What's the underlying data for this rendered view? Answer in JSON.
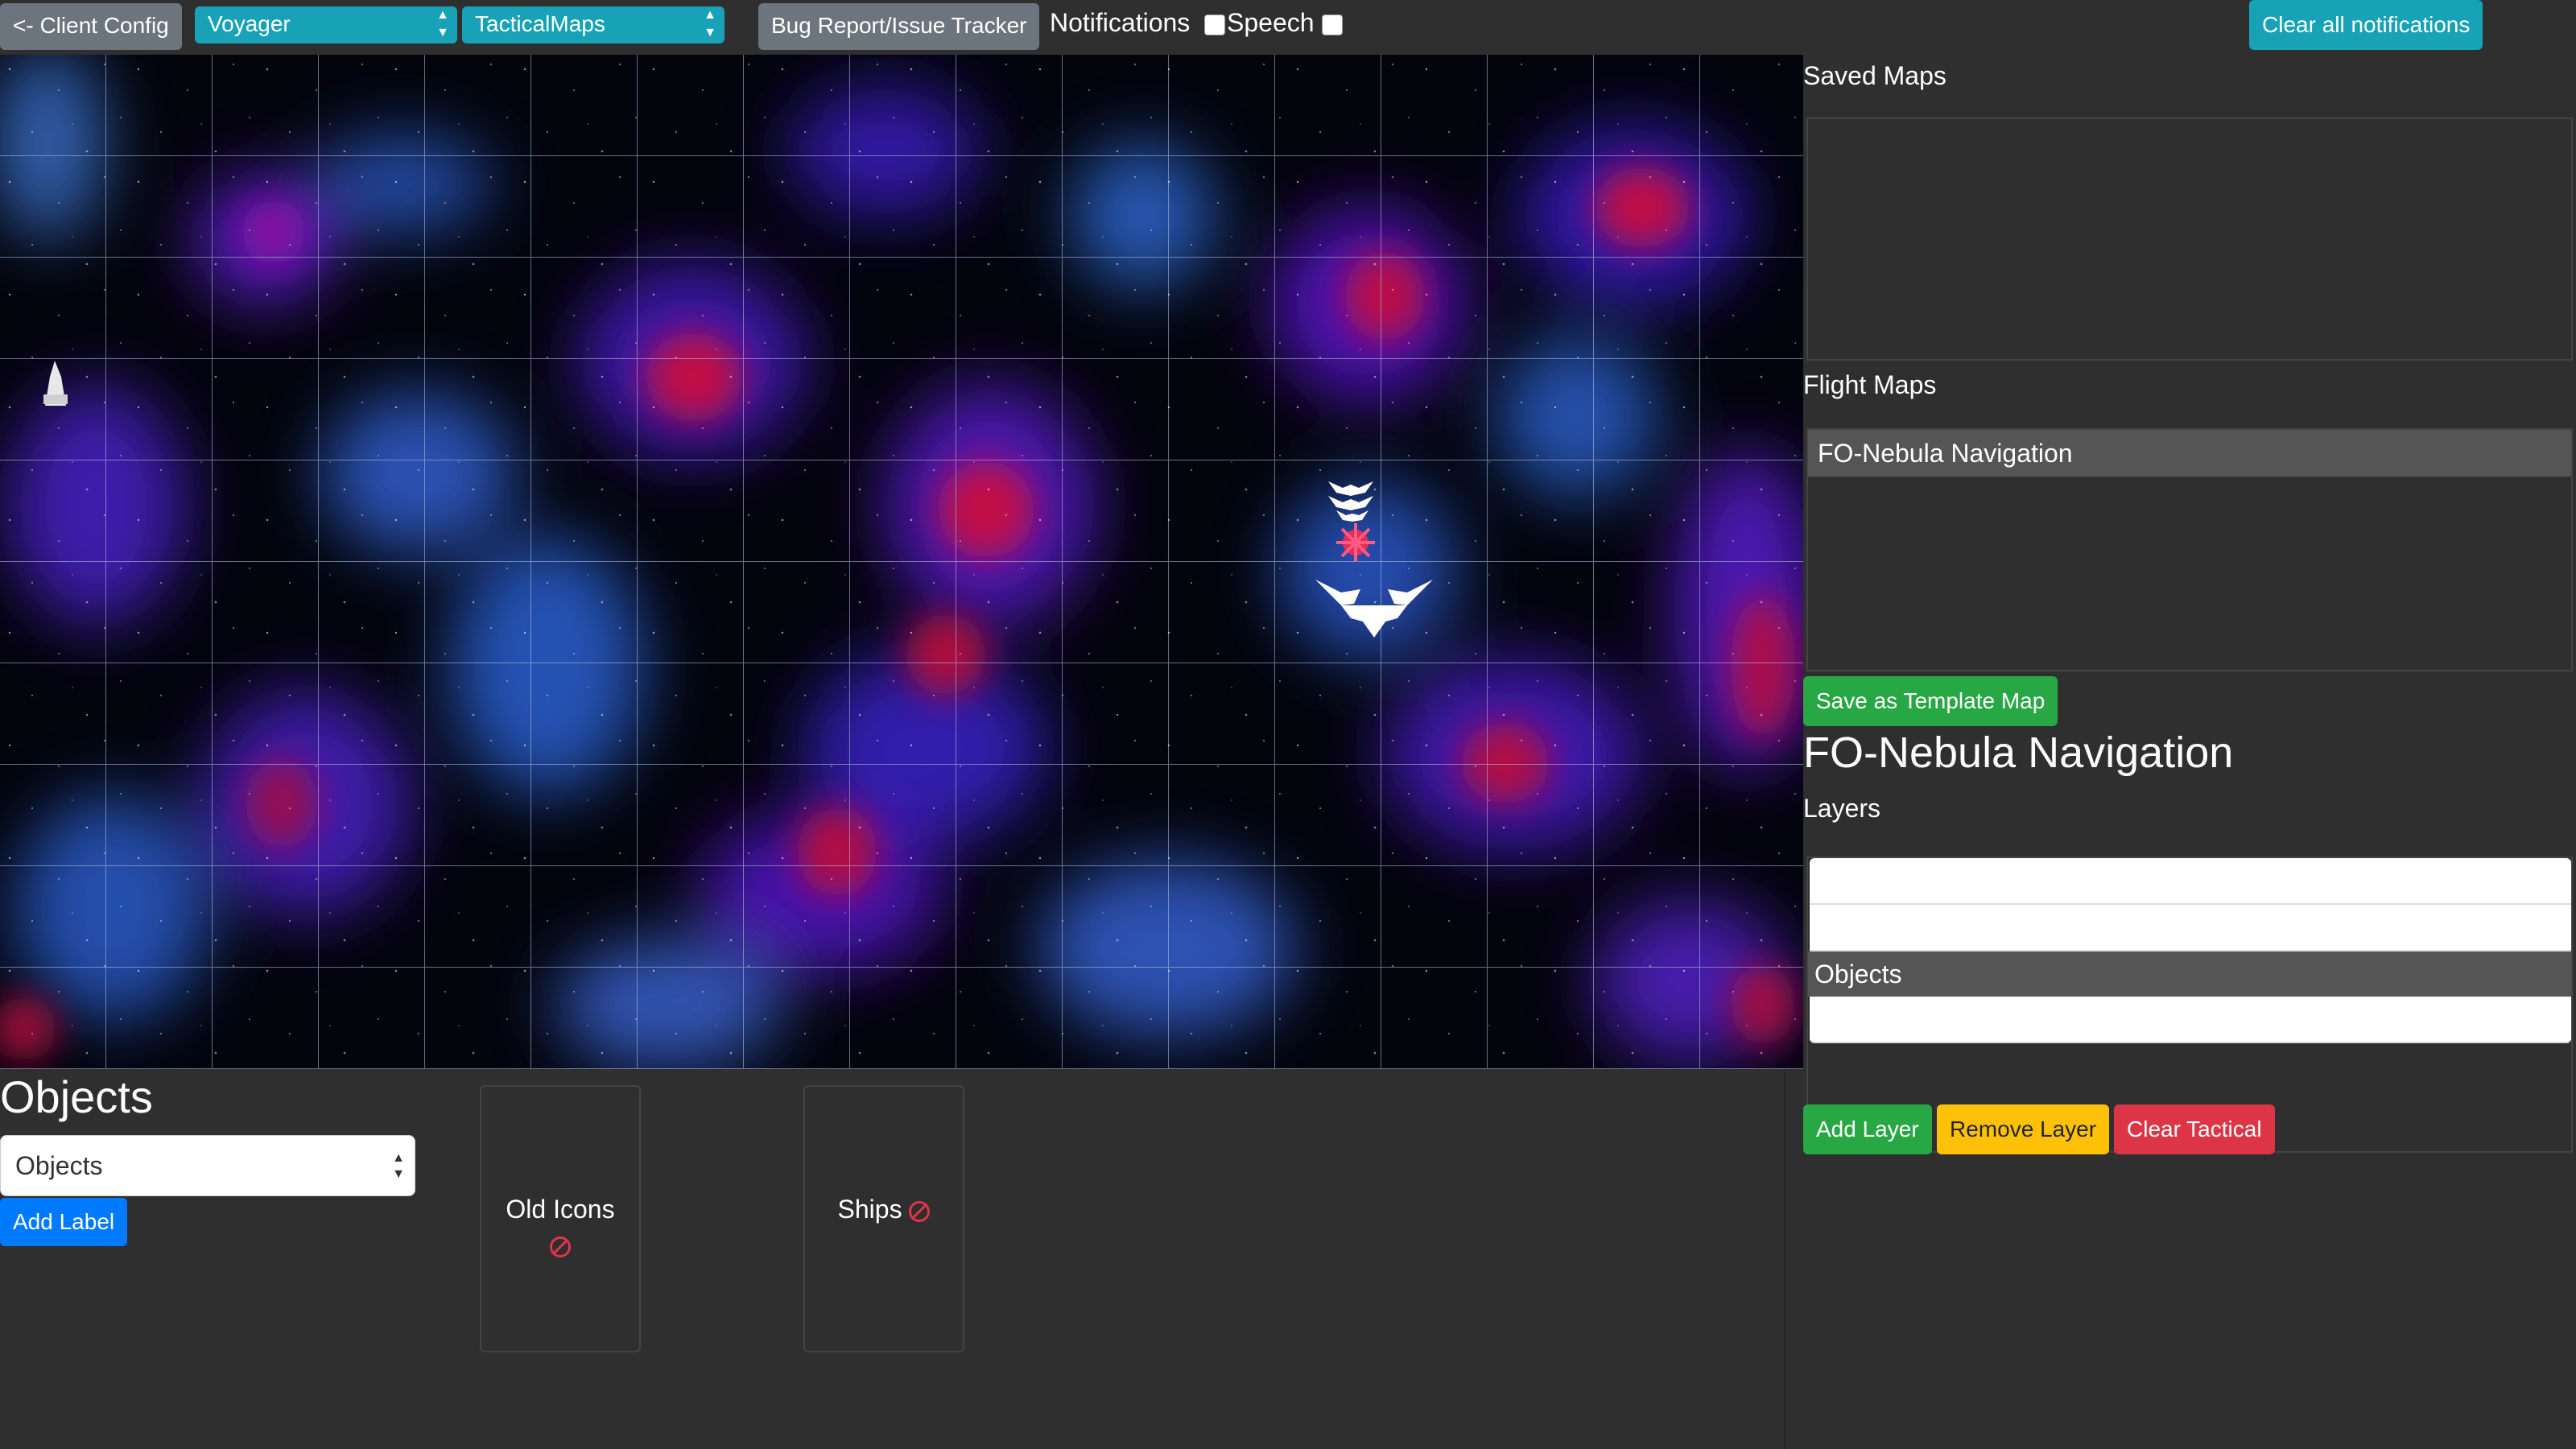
{
  "topbar": {
    "client_config": "<- Client Config",
    "simulator_select": "Voyager",
    "view_select": "TacticalMaps",
    "bug_report": "Bug Report/Issue Tracker",
    "notifications_label": "Notifications",
    "speech_label": "Speech",
    "clear_notifications": "Clear all notifications"
  },
  "map": {
    "background": "nebula-starfield",
    "contacts": [
      "shuttle-icon",
      "fighter-squadron-icon",
      "star-burst-icon",
      "winged-ship-icon"
    ]
  },
  "objects_panel": {
    "title": "Objects",
    "layer_select_value": "Objects",
    "add_label": "Add Label",
    "cards": [
      {
        "label": "Old Icons",
        "status_icon": "no-entry-icon"
      },
      {
        "label": "Ships",
        "status_icon": "no-entry-icon"
      }
    ]
  },
  "sidebar": {
    "saved_maps_label": "Saved Maps",
    "saved_maps": [],
    "flight_maps_label": "Flight Maps",
    "flight_maps": [
      "FO-Nebula Navigation"
    ],
    "save_template": "Save as Template Map",
    "current_map_title": "FO-Nebula Navigation",
    "layers_label": "Layers",
    "layers": [
      "",
      "",
      "Objects",
      ""
    ],
    "add_layer": "Add Layer",
    "remove_layer": "Remove Layer",
    "clear_tactical": "Clear Tactical"
  },
  "colors": {
    "info": "#17a2b8",
    "success": "#28a745",
    "warning": "#ffc107",
    "danger": "#dc3545",
    "primary": "#007bff",
    "secondary": "#6c757d",
    "background": "#2f2f2f"
  }
}
